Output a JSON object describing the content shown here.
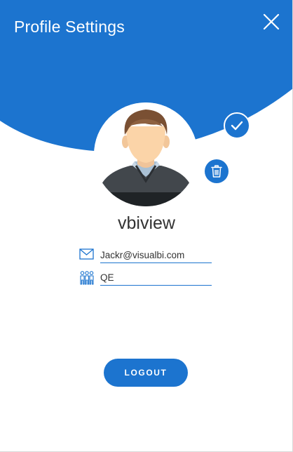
{
  "header": {
    "title": "Profile Settings",
    "accent_color": "#1c74cf"
  },
  "icons": {
    "close": "close-icon",
    "save": "check-icon",
    "delete": "trash-icon",
    "email": "envelope-icon",
    "team": "people-icon"
  },
  "profile": {
    "username": "vbiview",
    "email": "Jackr@visualbi.com",
    "team": "QE"
  },
  "actions": {
    "logout_label": "LOGOUT"
  }
}
